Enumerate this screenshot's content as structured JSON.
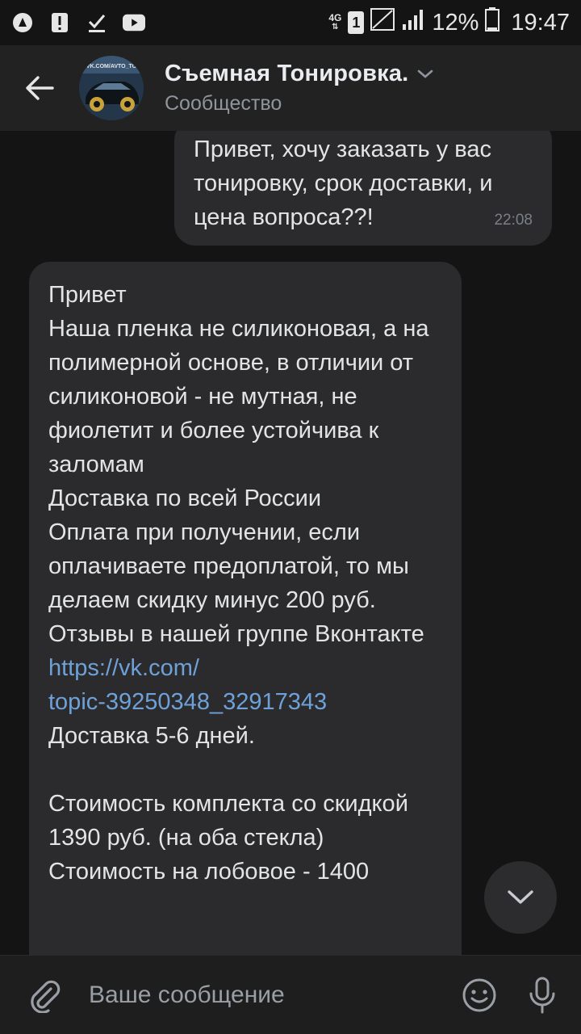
{
  "status_bar": {
    "network": "4G",
    "sim": "1",
    "battery": "12%",
    "time": "19:47",
    "icons": [
      "circle-a-icon",
      "alert-icon",
      "download-check-icon",
      "youtube-icon",
      "network-4g-icon",
      "sim-icon",
      "signal-icon",
      "battery-icon"
    ]
  },
  "header": {
    "title": "Съемная Тонировка.",
    "subtitle": "Сообщество",
    "avatar_text": "VK.COM/AVTO_TO"
  },
  "messages": {
    "outgoing": {
      "text": "Привет,  хочу заказать у вас тонировку, срок доставки, и цена вопроса??!",
      "time": "22:08"
    },
    "incoming": {
      "text_before_link": "Привет\nНаша пленка не силиконовая, а на полимерной основе, в отличии от силиконовой - не мутная, не фиолетит и более устойчива к заломам\nДоставка по всей России\nОплата при получении, если оплачиваете предоплатой, то мы делаем скидку минус 200 руб.\nОтзывы в нашей группе Вконтакте ",
      "link_line1": "https://vk.com/",
      "link_line2": "topic-39250348_32917343",
      "text_after_link": "\nДоставка 5-6 дней.\n\nСтоимость комплекта со скидкой 1390 руб. (на оба стекла)\nСтоимость на лобовое - 1400"
    }
  },
  "composer": {
    "placeholder": "Ваше сообщение"
  },
  "colors": {
    "background": "#141414",
    "header": "#222223",
    "bubble": "#2b2b2d",
    "link": "#6fa1d9",
    "muted_text": "#8f959c"
  }
}
